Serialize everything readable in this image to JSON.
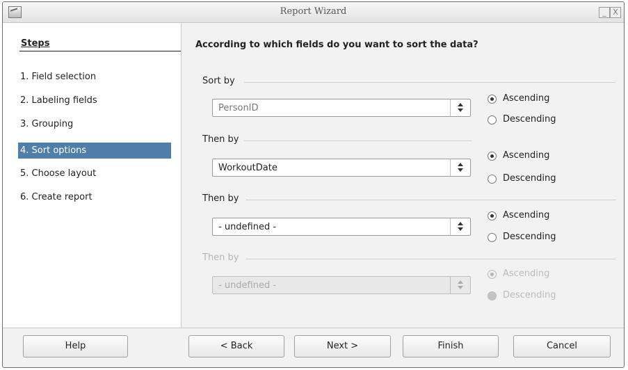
{
  "window": {
    "title": "Report Wizard",
    "minimize_glyph": "_",
    "close_glyph": "X"
  },
  "steps": {
    "title": "Steps",
    "items": [
      {
        "label": "1. Field selection",
        "active": false
      },
      {
        "label": "2. Labeling fields",
        "active": false
      },
      {
        "label": "3. Grouping",
        "active": false
      },
      {
        "label": "4. Sort options",
        "active": true
      },
      {
        "label": "5. Choose layout",
        "active": false
      },
      {
        "label": "6. Create report",
        "active": false
      }
    ]
  },
  "main": {
    "heading": "According to which fields do you want to sort the data?",
    "groups": [
      {
        "label": "Sort by",
        "value": "PersonID",
        "ascending": "Ascending",
        "descending": "Descending",
        "order": "ascending",
        "state": "readonly"
      },
      {
        "label": "Then by",
        "value": "WorkoutDate",
        "ascending": "Ascending",
        "descending": "Descending",
        "order": "ascending",
        "state": "enabled"
      },
      {
        "label": "Then by",
        "value": "- undefined -",
        "ascending": "Ascending",
        "descending": "Descending",
        "order": "ascending",
        "state": "enabled"
      },
      {
        "label": "Then by",
        "value": "- undefined -",
        "ascending": "Ascending",
        "descending": "Descending",
        "order": "ascending",
        "state": "disabled"
      }
    ]
  },
  "buttons": {
    "help": "Help",
    "back": "< Back",
    "next": "Next >",
    "finish": "Finish",
    "cancel": "Cancel"
  }
}
